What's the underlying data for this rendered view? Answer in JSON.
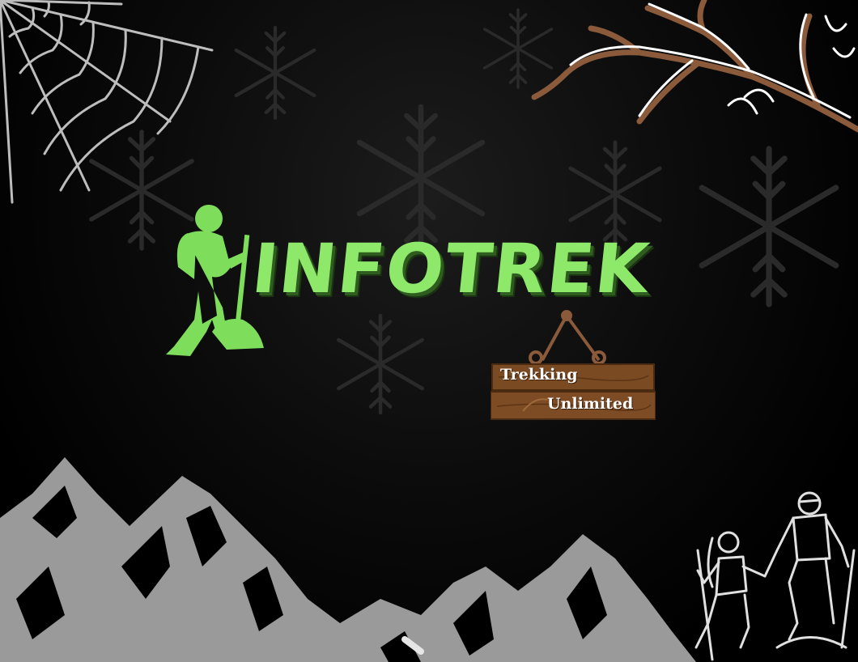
{
  "brand": {
    "title": "INFOTREK",
    "tagline_line1": "Trekking",
    "tagline_line2": "Unlimited"
  },
  "colors": {
    "background": "#000000",
    "accent_green": "#8ee86a",
    "sign_wood": "#7a4a22",
    "mountain_gray": "#9a9a9a",
    "branch_brown": "#8a5a3a"
  },
  "icons": [
    "spider-web-icon",
    "snowy-branch-icon",
    "hiker-icon",
    "mountains-icon",
    "hiking-couple-icon",
    "snowflake-icon"
  ]
}
